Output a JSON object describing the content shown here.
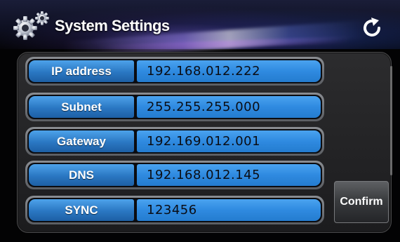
{
  "header": {
    "title": "System Settings",
    "settings_icon": "gear-icon",
    "refresh_icon": "refresh-icon"
  },
  "fields": [
    {
      "label": "IP address",
      "value": "192.168.012.222"
    },
    {
      "label": "Subnet",
      "value": "255.255.255.000"
    },
    {
      "label": "Gateway",
      "value": "192.169.012.001"
    },
    {
      "label": "DNS",
      "value": "192.168.012.145"
    },
    {
      "label": "SYNC",
      "value": "123456"
    }
  ],
  "actions": {
    "confirm_label": "Confirm"
  },
  "colors": {
    "label_blue": "#2a77c2",
    "value_blue": "#2f8ae0",
    "panel": "#2c2c2e"
  }
}
